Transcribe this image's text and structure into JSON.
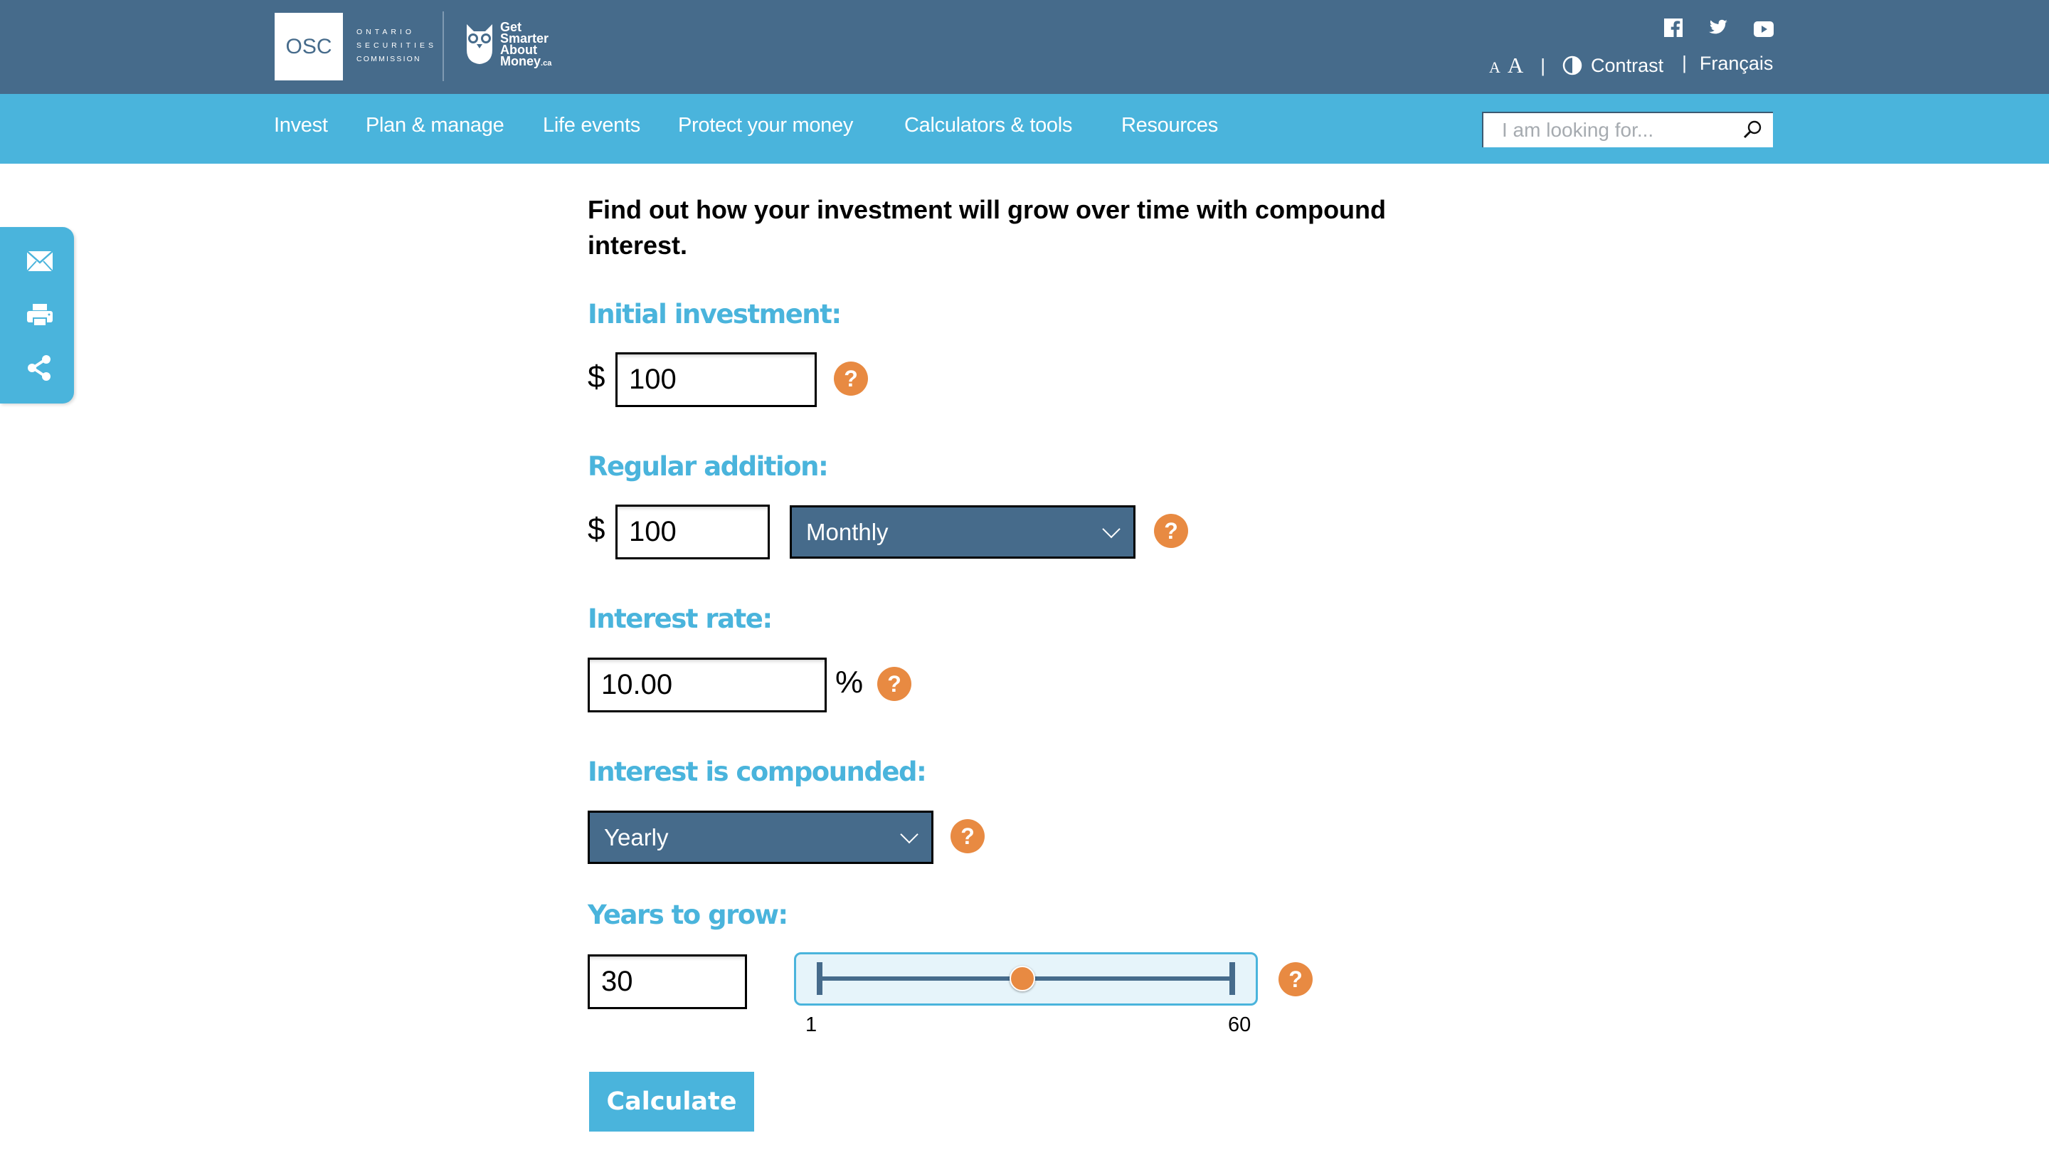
{
  "header": {
    "logo_abbr": "OSC",
    "org_name_lines": [
      "ONTARIO",
      "SECURITIES",
      "COMMISSION"
    ],
    "brand_lines": [
      "Get",
      "Smarter",
      "About",
      "Money"
    ],
    "brand_suffix": ".ca",
    "social": [
      {
        "name": "facebook-icon"
      },
      {
        "name": "twitter-icon"
      },
      {
        "name": "youtube-icon"
      }
    ],
    "font_small": "A",
    "font_large": "A",
    "separator": "|",
    "contrast_label": "Contrast",
    "language_label": "Français"
  },
  "nav": {
    "items": [
      {
        "label": "Invest"
      },
      {
        "label": "Plan & manage"
      },
      {
        "label": "Life events"
      },
      {
        "label": "Protect your money"
      },
      {
        "label": "Calculators & tools"
      },
      {
        "label": "Resources"
      }
    ],
    "search_placeholder": "I am looking for...",
    "search_value": ""
  },
  "share_sidebar": {
    "icons": [
      "email-icon",
      "print-icon",
      "share-icon"
    ]
  },
  "calculator": {
    "intro": "Find out how your investment will grow over time with compound interest.",
    "initial_investment": {
      "label": "Initial investment:",
      "currency": "$",
      "value": "100",
      "help": "?"
    },
    "regular_addition": {
      "label": "Regular addition:",
      "currency": "$",
      "value": "100",
      "frequency": "Monthly",
      "help": "?"
    },
    "interest_rate": {
      "label": "Interest rate:",
      "value": "10.00",
      "unit": "%",
      "help": "?"
    },
    "compounding": {
      "label": "Interest is compounded:",
      "value": "Yearly",
      "help": "?"
    },
    "years": {
      "label": "Years to grow:",
      "value": "30",
      "slider_min": 1,
      "slider_max": 60,
      "slider_value": 30,
      "min_label": "1",
      "max_label": "60",
      "help": "?"
    },
    "calculate_label": "Calculate"
  },
  "colors": {
    "header_dark": "#466b8b",
    "nav_blue": "#4ab4dc",
    "help_orange": "#e88a42"
  }
}
